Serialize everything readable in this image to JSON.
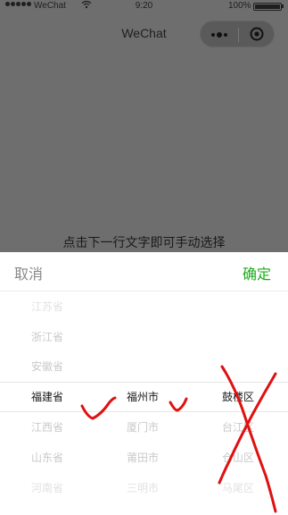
{
  "status_bar": {
    "carrier": "WeChat",
    "time": "9:20",
    "battery_percent": "100%"
  },
  "nav": {
    "title": "WeChat"
  },
  "hint": "点击下一行文字即可手动选择",
  "picker": {
    "cancel_label": "取消",
    "confirm_label": "确定",
    "confirm_color": "#1aad19",
    "provinces": [
      "江苏省",
      "浙江省",
      "安徽省",
      "福建省",
      "江西省",
      "山东省",
      "河南省"
    ],
    "cities": [
      "福州市",
      "厦门市",
      "莆田市",
      "三明市"
    ],
    "districts": [
      "鼓楼区",
      "台江区",
      "仓山区",
      "马尾区"
    ],
    "selected": {
      "province": "福建省",
      "city": "福州市",
      "district": "鼓楼区"
    }
  },
  "annotations": {
    "checkmarks": 2,
    "cross_mark": 1,
    "color": "#e01010"
  }
}
